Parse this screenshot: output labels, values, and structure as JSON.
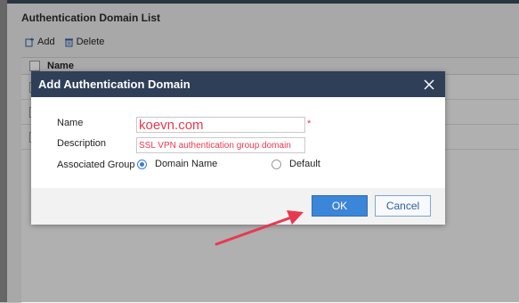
{
  "page": {
    "title": "Authentication Domain List",
    "toolbar": {
      "add_label": "Add",
      "delete_label": "Delete"
    },
    "table": {
      "header_name": "Name",
      "rows": [
        "",
        "",
        ""
      ]
    }
  },
  "dialog": {
    "title": "Add Authentication Domain",
    "fields": {
      "name_label": "Name",
      "name_value": "koevn.com",
      "required_mark": "*",
      "description_label": "Description",
      "description_value": "SSL VPN authentication group domain",
      "group_label": "Associated Group"
    },
    "group_options": [
      {
        "label": "Domain Name",
        "selected": true
      },
      {
        "label": "Default",
        "selected": false
      }
    ],
    "buttons": {
      "ok": "OK",
      "cancel": "Cancel"
    }
  },
  "colors": {
    "header_bg": "#2f3f57",
    "primary_button": "#3c86d9",
    "annotation_red": "#e8394f"
  },
  "icons": [
    "add-icon",
    "delete-icon",
    "close-icon",
    "radio-icon"
  ]
}
